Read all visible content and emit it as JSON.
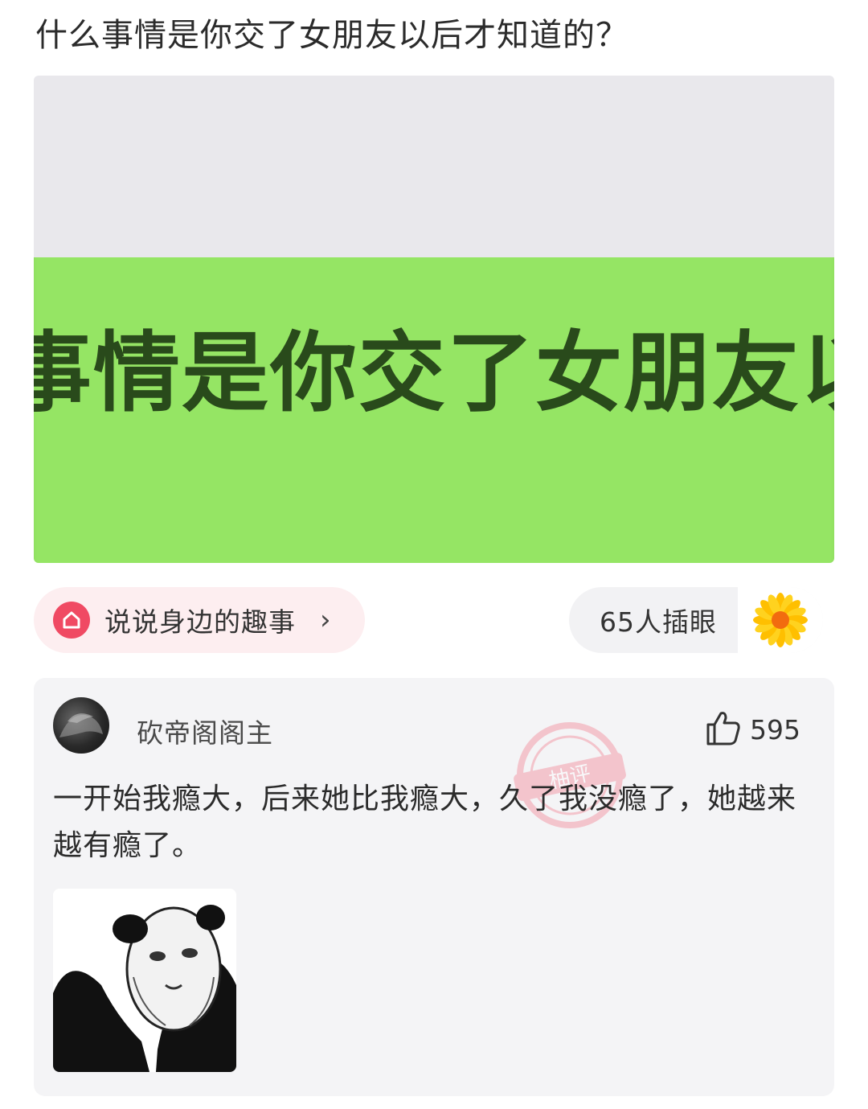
{
  "post": {
    "title": "什么事情是你交了女朋友以后才知道的？",
    "image_text": "事情是你交了女朋友以后"
  },
  "topic_chip": {
    "label": "说说身边的趣事",
    "chevron": "›",
    "icon": "home-icon",
    "accent_color": "#f04a63"
  },
  "reaction_chip": {
    "count_label": "65人插眼",
    "icon": "sunflower-icon"
  },
  "comment": {
    "username": "砍帝阁阁主",
    "likes": "595",
    "like_icon": "thumbs-up-icon",
    "text": "一开始我瘾大，后来她比我瘾大，久了我没瘾了，她越来越有瘾了。",
    "watermark_text": "柚评",
    "attachment": "panda-meme-image"
  },
  "colors": {
    "green_band": "#95e564",
    "card_bg": "#f4f4f6",
    "chip_pink_bg": "#fdeef0"
  }
}
